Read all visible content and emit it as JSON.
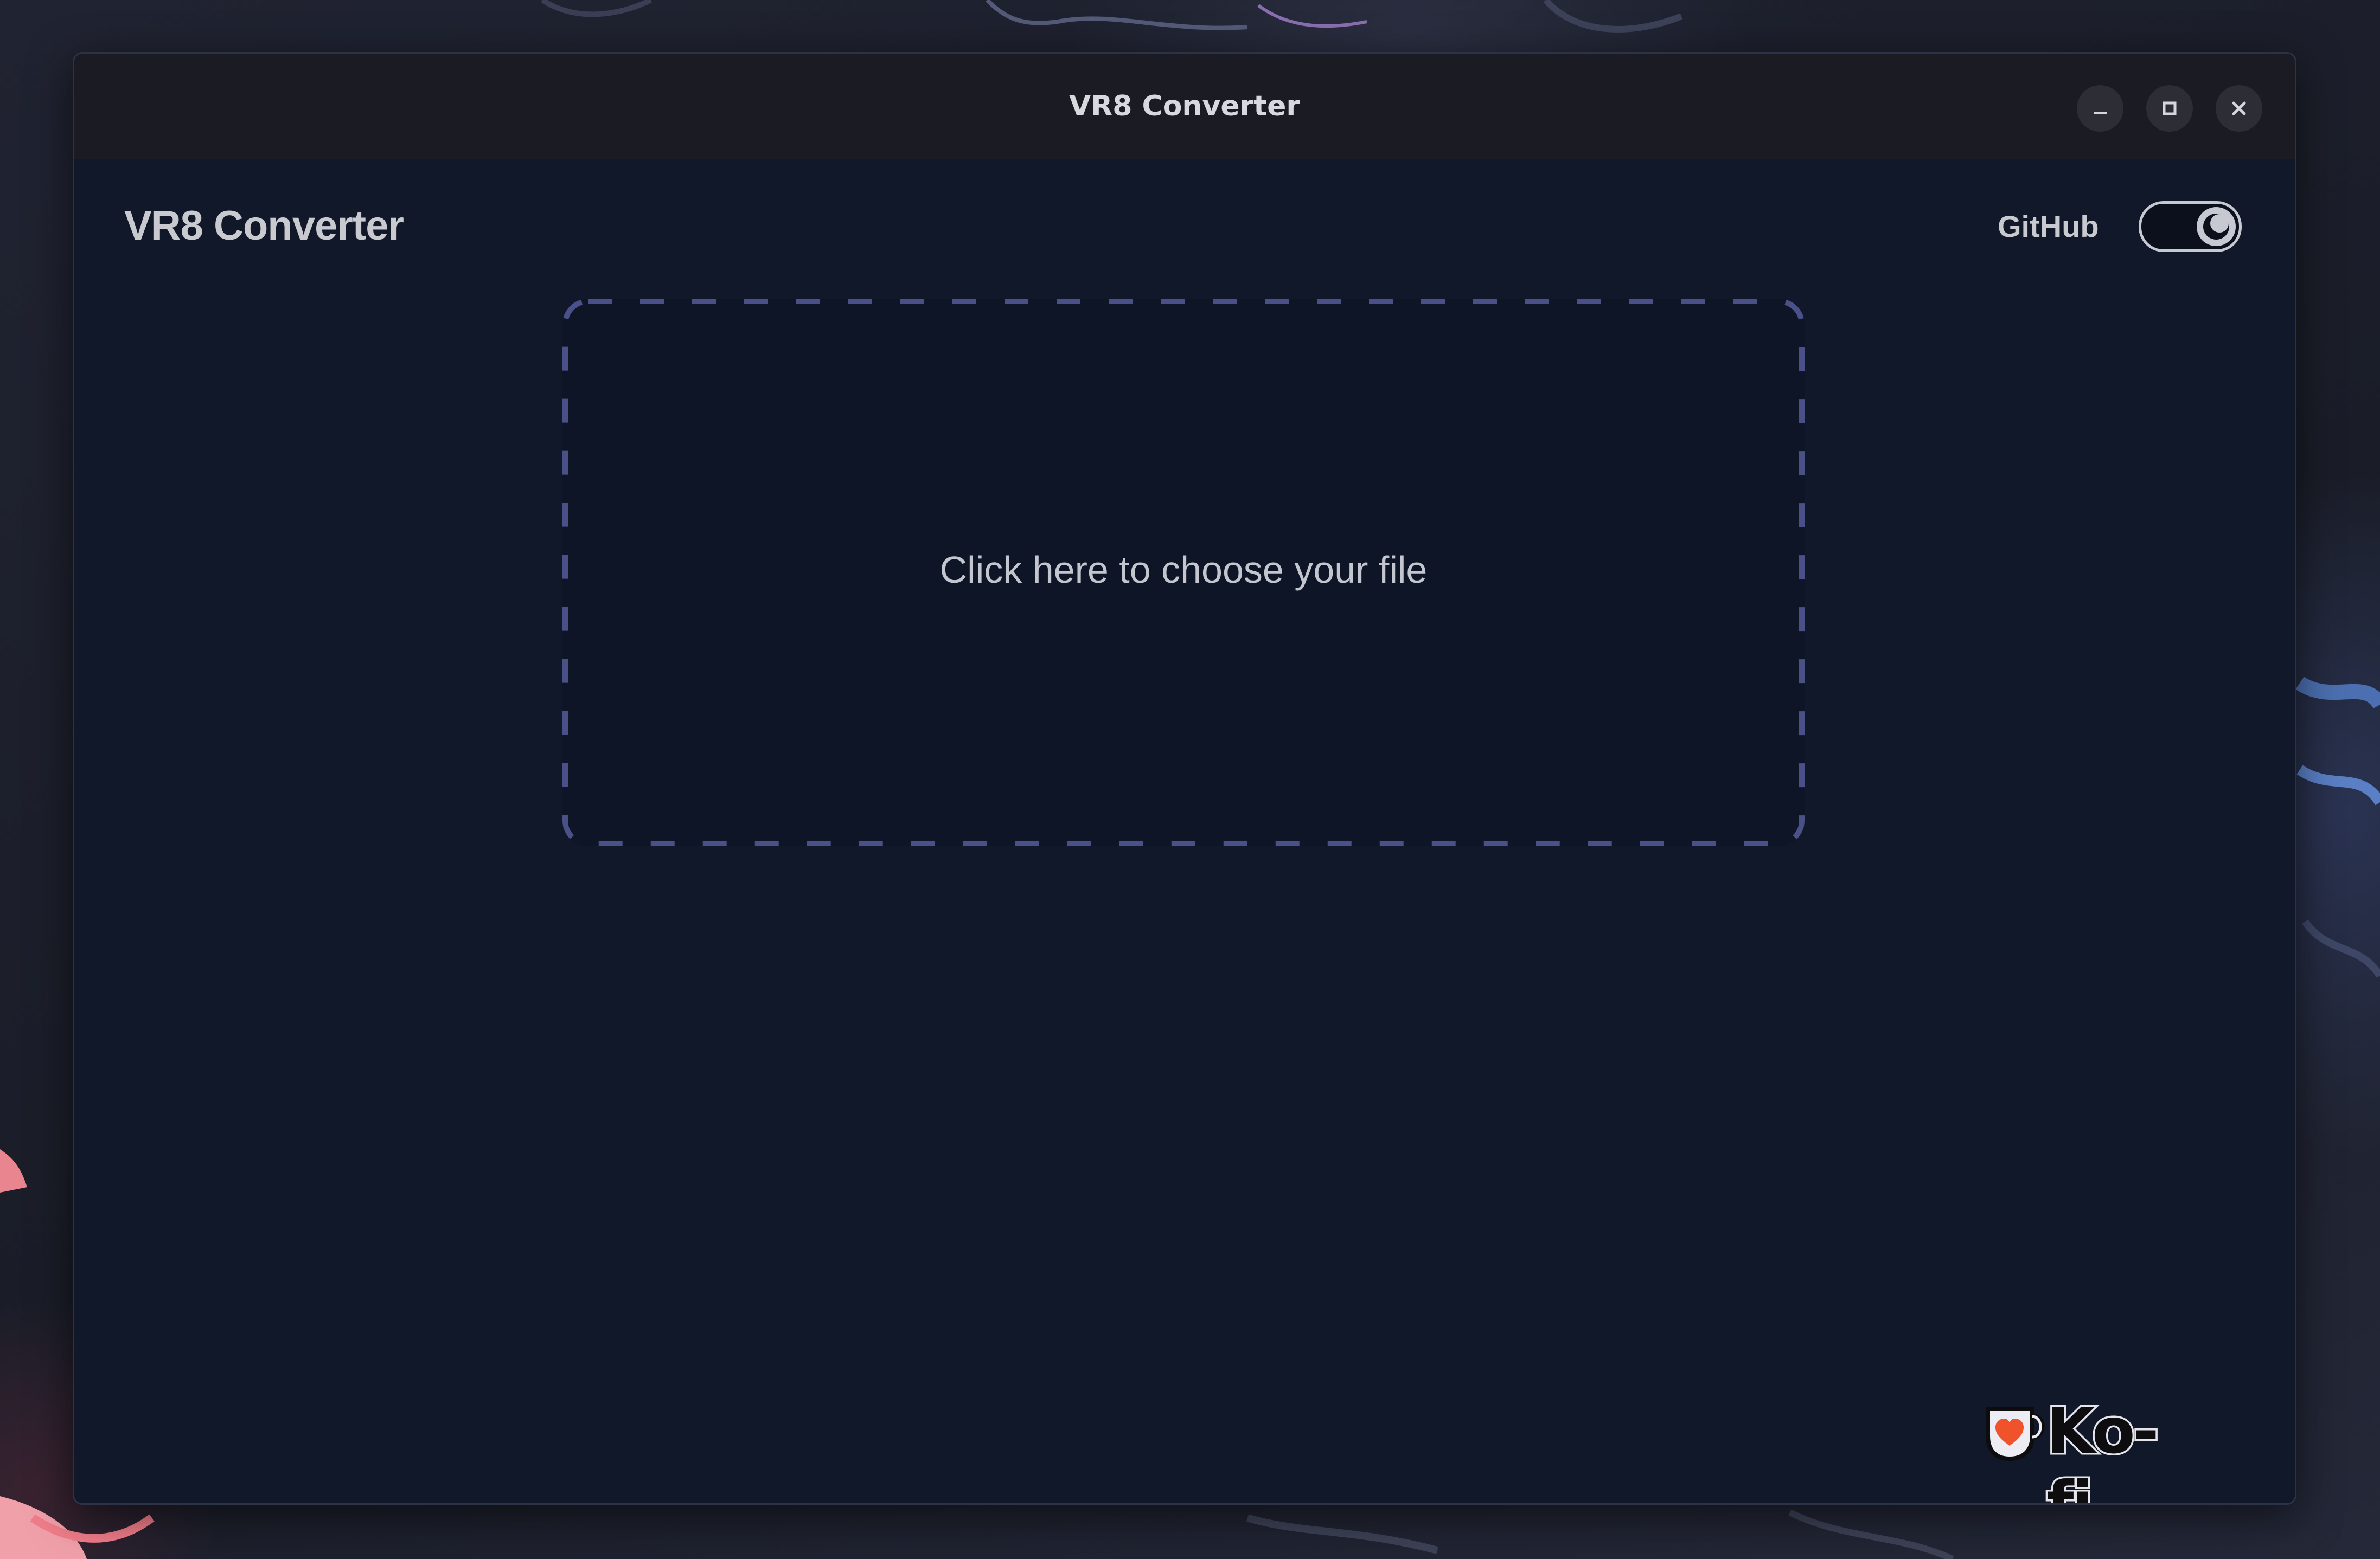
{
  "window": {
    "title": "VR8 Converter",
    "controls": {
      "minimize_icon": "minimize-icon",
      "maximize_icon": "maximize-icon",
      "close_icon": "close-icon"
    }
  },
  "header": {
    "app_title": "VR8 Converter",
    "github_label": "GitHub",
    "theme_toggle": {
      "icon": "moon-icon",
      "state": "dark"
    }
  },
  "dropzone": {
    "label": "Click here to choose your file",
    "border_color": "#4a5189"
  },
  "footer": {
    "kofi_label": "Ko-fi",
    "kofi_icon": "kofi-cup-heart-icon"
  },
  "colors": {
    "window_background": "#111829",
    "titlebar_background": "#1b1c23",
    "text": "#c9cad0",
    "kofi_heart": "#f0522b"
  }
}
